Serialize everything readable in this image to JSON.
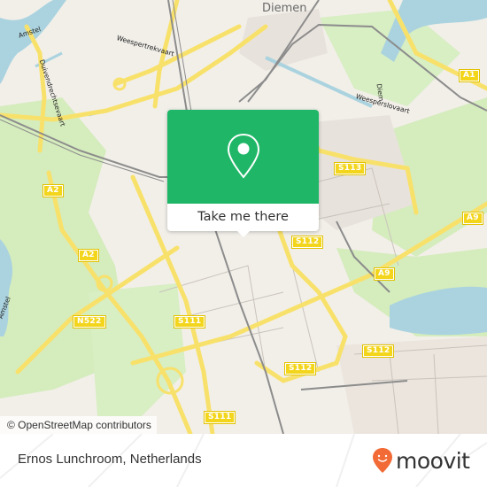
{
  "map": {
    "place_labels": [
      {
        "name": "diemen",
        "text": "Diemen"
      }
    ],
    "street_labels": [
      {
        "name": "amstel",
        "text": "Amstel"
      },
      {
        "name": "weespertrekvaart",
        "text": "Weespertrekvaart"
      },
      {
        "name": "duivendrechtsevaart",
        "text": "Duivendrechtsevaart"
      },
      {
        "name": "diem",
        "text": "Diem"
      },
      {
        "name": "weesperslowaart",
        "text": "Weesperslovaart"
      },
      {
        "name": "amstel-sw",
        "text": "Amstel"
      }
    ],
    "road_shields": [
      {
        "name": "a1",
        "text": "A1"
      },
      {
        "name": "a2-north",
        "text": "A2"
      },
      {
        "name": "a2-south",
        "text": "A2"
      },
      {
        "name": "s113",
        "text": "S113"
      },
      {
        "name": "a9-east",
        "text": "A9"
      },
      {
        "name": "s112-north",
        "text": "S112"
      },
      {
        "name": "a9-center",
        "text": "A9"
      },
      {
        "name": "n522",
        "text": "N522"
      },
      {
        "name": "s111-center",
        "text": "S111"
      },
      {
        "name": "s112-south",
        "text": "S112"
      },
      {
        "name": "s112-southwest",
        "text": "S112"
      },
      {
        "name": "s111-south",
        "text": "S111"
      }
    ],
    "colors": {
      "land": "#f2efe9",
      "water": "#aad3df",
      "park": "#cdebb0",
      "motorway": "#f8e16a",
      "rail": "#8c8c8c",
      "shield": "#f3d51c"
    }
  },
  "popup": {
    "icon": "map-pin-icon",
    "button_label": "Take me there",
    "accent_color": "#1fb767"
  },
  "attribution": "© OpenStreetMap contributors",
  "footer": {
    "place_name": "Ernos Lunchroom, Netherlands",
    "brand": "moovit",
    "brand_color": "#f26a35"
  }
}
